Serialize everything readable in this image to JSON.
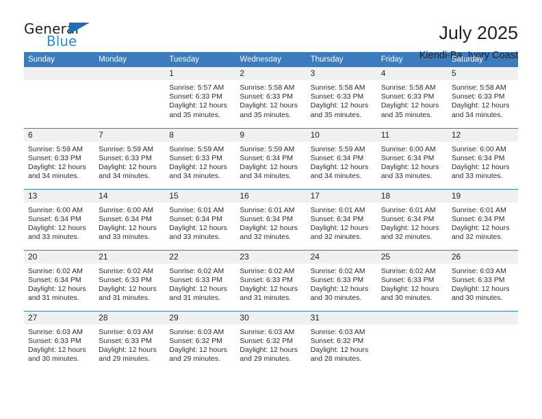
{
  "brand": {
    "name_top": "General",
    "name_bottom": "Blue",
    "triangle_icon": "triangle-icon",
    "accent_color": "#1c6fb5",
    "blue_text_color": "#2a8fd4"
  },
  "header": {
    "month_title": "July 2025",
    "location": "Kiendi-Ba, Ivory Coast"
  },
  "calendar": {
    "header_bg": "#3b7cbf",
    "daynum_bg": "#f0f0f0",
    "weekday_headers": [
      "Sunday",
      "Monday",
      "Tuesday",
      "Wednesday",
      "Thursday",
      "Friday",
      "Saturday"
    ],
    "weeks": [
      [
        {
          "day": "",
          "lines": []
        },
        {
          "day": "",
          "lines": []
        },
        {
          "day": "1",
          "lines": [
            "Sunrise: 5:57 AM",
            "Sunset: 6:33 PM",
            "Daylight: 12 hours",
            "and 35 minutes."
          ]
        },
        {
          "day": "2",
          "lines": [
            "Sunrise: 5:58 AM",
            "Sunset: 6:33 PM",
            "Daylight: 12 hours",
            "and 35 minutes."
          ]
        },
        {
          "day": "3",
          "lines": [
            "Sunrise: 5:58 AM",
            "Sunset: 6:33 PM",
            "Daylight: 12 hours",
            "and 35 minutes."
          ]
        },
        {
          "day": "4",
          "lines": [
            "Sunrise: 5:58 AM",
            "Sunset: 6:33 PM",
            "Daylight: 12 hours",
            "and 35 minutes."
          ]
        },
        {
          "day": "5",
          "lines": [
            "Sunrise: 5:58 AM",
            "Sunset: 6:33 PM",
            "Daylight: 12 hours",
            "and 34 minutes."
          ]
        }
      ],
      [
        {
          "day": "6",
          "lines": [
            "Sunrise: 5:59 AM",
            "Sunset: 6:33 PM",
            "Daylight: 12 hours",
            "and 34 minutes."
          ]
        },
        {
          "day": "7",
          "lines": [
            "Sunrise: 5:59 AM",
            "Sunset: 6:33 PM",
            "Daylight: 12 hours",
            "and 34 minutes."
          ]
        },
        {
          "day": "8",
          "lines": [
            "Sunrise: 5:59 AM",
            "Sunset: 6:33 PM",
            "Daylight: 12 hours",
            "and 34 minutes."
          ]
        },
        {
          "day": "9",
          "lines": [
            "Sunrise: 5:59 AM",
            "Sunset: 6:34 PM",
            "Daylight: 12 hours",
            "and 34 minutes."
          ]
        },
        {
          "day": "10",
          "lines": [
            "Sunrise: 5:59 AM",
            "Sunset: 6:34 PM",
            "Daylight: 12 hours",
            "and 34 minutes."
          ]
        },
        {
          "day": "11",
          "lines": [
            "Sunrise: 6:00 AM",
            "Sunset: 6:34 PM",
            "Daylight: 12 hours",
            "and 33 minutes."
          ]
        },
        {
          "day": "12",
          "lines": [
            "Sunrise: 6:00 AM",
            "Sunset: 6:34 PM",
            "Daylight: 12 hours",
            "and 33 minutes."
          ]
        }
      ],
      [
        {
          "day": "13",
          "lines": [
            "Sunrise: 6:00 AM",
            "Sunset: 6:34 PM",
            "Daylight: 12 hours",
            "and 33 minutes."
          ]
        },
        {
          "day": "14",
          "lines": [
            "Sunrise: 6:00 AM",
            "Sunset: 6:34 PM",
            "Daylight: 12 hours",
            "and 33 minutes."
          ]
        },
        {
          "day": "15",
          "lines": [
            "Sunrise: 6:01 AM",
            "Sunset: 6:34 PM",
            "Daylight: 12 hours",
            "and 33 minutes."
          ]
        },
        {
          "day": "16",
          "lines": [
            "Sunrise: 6:01 AM",
            "Sunset: 6:34 PM",
            "Daylight: 12 hours",
            "and 32 minutes."
          ]
        },
        {
          "day": "17",
          "lines": [
            "Sunrise: 6:01 AM",
            "Sunset: 6:34 PM",
            "Daylight: 12 hours",
            "and 32 minutes."
          ]
        },
        {
          "day": "18",
          "lines": [
            "Sunrise: 6:01 AM",
            "Sunset: 6:34 PM",
            "Daylight: 12 hours",
            "and 32 minutes."
          ]
        },
        {
          "day": "19",
          "lines": [
            "Sunrise: 6:01 AM",
            "Sunset: 6:34 PM",
            "Daylight: 12 hours",
            "and 32 minutes."
          ]
        }
      ],
      [
        {
          "day": "20",
          "lines": [
            "Sunrise: 6:02 AM",
            "Sunset: 6:34 PM",
            "Daylight: 12 hours",
            "and 31 minutes."
          ]
        },
        {
          "day": "21",
          "lines": [
            "Sunrise: 6:02 AM",
            "Sunset: 6:33 PM",
            "Daylight: 12 hours",
            "and 31 minutes."
          ]
        },
        {
          "day": "22",
          "lines": [
            "Sunrise: 6:02 AM",
            "Sunset: 6:33 PM",
            "Daylight: 12 hours",
            "and 31 minutes."
          ]
        },
        {
          "day": "23",
          "lines": [
            "Sunrise: 6:02 AM",
            "Sunset: 6:33 PM",
            "Daylight: 12 hours",
            "and 31 minutes."
          ]
        },
        {
          "day": "24",
          "lines": [
            "Sunrise: 6:02 AM",
            "Sunset: 6:33 PM",
            "Daylight: 12 hours",
            "and 30 minutes."
          ]
        },
        {
          "day": "25",
          "lines": [
            "Sunrise: 6:02 AM",
            "Sunset: 6:33 PM",
            "Daylight: 12 hours",
            "and 30 minutes."
          ]
        },
        {
          "day": "26",
          "lines": [
            "Sunrise: 6:03 AM",
            "Sunset: 6:33 PM",
            "Daylight: 12 hours",
            "and 30 minutes."
          ]
        }
      ],
      [
        {
          "day": "27",
          "lines": [
            "Sunrise: 6:03 AM",
            "Sunset: 6:33 PM",
            "Daylight: 12 hours",
            "and 30 minutes."
          ]
        },
        {
          "day": "28",
          "lines": [
            "Sunrise: 6:03 AM",
            "Sunset: 6:33 PM",
            "Daylight: 12 hours",
            "and 29 minutes."
          ]
        },
        {
          "day": "29",
          "lines": [
            "Sunrise: 6:03 AM",
            "Sunset: 6:32 PM",
            "Daylight: 12 hours",
            "and 29 minutes."
          ]
        },
        {
          "day": "30",
          "lines": [
            "Sunrise: 6:03 AM",
            "Sunset: 6:32 PM",
            "Daylight: 12 hours",
            "and 29 minutes."
          ]
        },
        {
          "day": "31",
          "lines": [
            "Sunrise: 6:03 AM",
            "Sunset: 6:32 PM",
            "Daylight: 12 hours",
            "and 28 minutes."
          ]
        },
        {
          "day": "",
          "lines": []
        },
        {
          "day": "",
          "lines": []
        }
      ]
    ]
  }
}
